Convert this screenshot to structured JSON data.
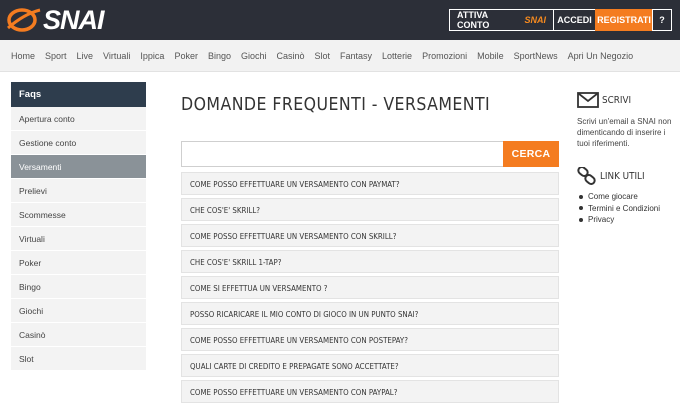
{
  "header": {
    "logo_text": "SNAI",
    "buttons": {
      "attiva": "ATTIVA CONTO",
      "attiva_badge": "SNAI",
      "accedi": "ACCEDI",
      "registrati": "REGISTRATI",
      "help": "?"
    },
    "colors": {
      "bar": "#2c2f38",
      "accent": "#f47c20"
    }
  },
  "nav": {
    "items": [
      "Home",
      "Sport",
      "Live",
      "Virtuali",
      "Ippica",
      "Poker",
      "Bingo",
      "Giochi",
      "Casinò",
      "Slot",
      "Fantasy",
      "Lotterie",
      "Promozioni",
      "Mobile",
      "SportNews",
      "Apri Un Negozio"
    ]
  },
  "sidebar": {
    "title": "Faqs",
    "items": [
      "Apertura conto",
      "Gestione conto",
      "Versamenti",
      "Prelievi",
      "Scommesse",
      "Virtuali",
      "Poker",
      "Bingo",
      "Giochi",
      "Casinò",
      "Slot"
    ],
    "active_index": 2
  },
  "main": {
    "title": "DOMANDE FREQUENTI - VERSAMENTI",
    "search": {
      "value": "",
      "button_label": "CERCA"
    },
    "faqs": [
      "COME POSSO EFFETTUARE UN VERSAMENTO CON PAYMAT?",
      "CHE COS'E' SKRILL?",
      "COME POSSO EFFETTUARE UN VERSAMENTO CON SKRILL?",
      "CHE COS'E' SKRILL 1-TAP?",
      "COME SI EFFETTUA UN VERSAMENTO ?",
      "POSSO RICARICARE IL MIO CONTO DI GIOCO IN UN PUNTO SNAI?",
      "COME POSSO EFFETTUARE UN VERSAMENTO CON POSTEPAY?",
      "QUALI CARTE DI CREDITO E PREPAGATE SONO ACCETTATE?",
      "COME POSSO EFFETTUARE UN VERSAMENTO CON PAYPAL?"
    ]
  },
  "right": {
    "scrivi": {
      "icon": "envelope-icon",
      "title": "SCRIVI",
      "text": "Scrivi un'email a SNAI non dimenticando di inserire i tuoi riferimenti."
    },
    "links": {
      "icon": "link-icon",
      "title": "LINK UTILI",
      "items": [
        "Come giocare",
        "Termini e Condizioni",
        "Privacy"
      ]
    }
  }
}
